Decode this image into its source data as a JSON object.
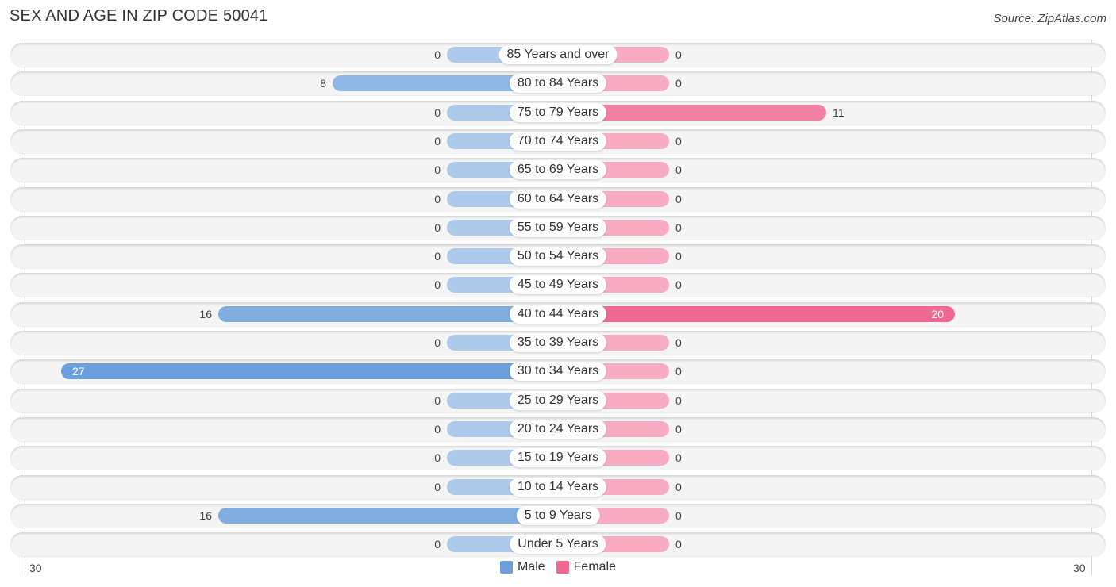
{
  "chart_data": {
    "type": "bar",
    "orientation": "horizontal-diverging",
    "title": "SEX AND AGE IN ZIP CODE 50041",
    "source": "Source: ZipAtlas.com",
    "categories": [
      "85 Years and over",
      "80 to 84 Years",
      "75 to 79 Years",
      "70 to 74 Years",
      "65 to 69 Years",
      "60 to 64 Years",
      "55 to 59 Years",
      "50 to 54 Years",
      "45 to 49 Years",
      "40 to 44 Years",
      "35 to 39 Years",
      "30 to 34 Years",
      "25 to 29 Years",
      "20 to 24 Years",
      "15 to 19 Years",
      "10 to 14 Years",
      "5 to 9 Years",
      "Under 5 Years"
    ],
    "series": [
      {
        "name": "Male",
        "color": "#6a9fdb",
        "values": [
          0,
          8,
          0,
          0,
          0,
          0,
          0,
          0,
          0,
          16,
          0,
          27,
          0,
          0,
          0,
          0,
          16,
          0
        ]
      },
      {
        "name": "Female",
        "color": "#f06892",
        "values": [
          0,
          0,
          11,
          0,
          0,
          0,
          0,
          0,
          0,
          20,
          0,
          0,
          0,
          0,
          0,
          0,
          0,
          0
        ]
      }
    ],
    "xlim": [
      30,
      30
    ],
    "tick_labels": {
      "left": "30",
      "right": "30"
    },
    "legend": {
      "position": "bottom-center",
      "entries": [
        "Male",
        "Female"
      ]
    }
  }
}
